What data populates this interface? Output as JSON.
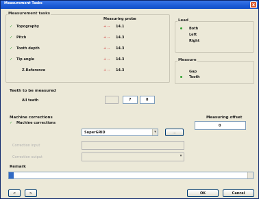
{
  "window": {
    "title": "Measurement Tasks",
    "close_glyph": "x"
  },
  "measurement_tasks": {
    "header": "Measurement tasks",
    "col_header": "Measuring probe",
    "rows": [
      {
        "label": "Topography",
        "checked": true,
        "probe_pos": "+ --",
        "value": "14.1"
      },
      {
        "label": "Pitch",
        "checked": true,
        "probe_pos": "+ --",
        "value": "14.3"
      },
      {
        "label": "Tooth depth",
        "checked": true,
        "probe_pos": "+ --",
        "value": "14.3"
      },
      {
        "label": "Tip angle",
        "checked": true,
        "probe_pos": "+ --",
        "value": "14.3"
      },
      {
        "label": "Z-Reference",
        "checked": false,
        "probe_pos": "+ --",
        "value": "14.3"
      }
    ]
  },
  "lead": {
    "header": "Lead",
    "options": [
      "Both",
      "Left",
      "Right"
    ],
    "selected": "Both"
  },
  "measure": {
    "header": "Measure",
    "options": [
      "Gap",
      "Tooth"
    ],
    "selected": "Tooth"
  },
  "teeth": {
    "header": "Teeth to be measured",
    "all_label": "All teeth",
    "field1": "",
    "field2": "7",
    "field3": "8"
  },
  "machine": {
    "header": "Machine corrections",
    "check_label": "Machine corrections",
    "dropdown_value": "SuperGRID",
    "browse_label": "...",
    "disabled_label1": "Correction input",
    "disabled_label2": "Correction output"
  },
  "measuring_offset": {
    "header": "Measuring offset",
    "value": "0"
  },
  "remark": {
    "header": "Remark",
    "value": ""
  },
  "footer": {
    "prev": "<",
    "next": ">",
    "ok": "OK",
    "cancel": "Cancel"
  }
}
